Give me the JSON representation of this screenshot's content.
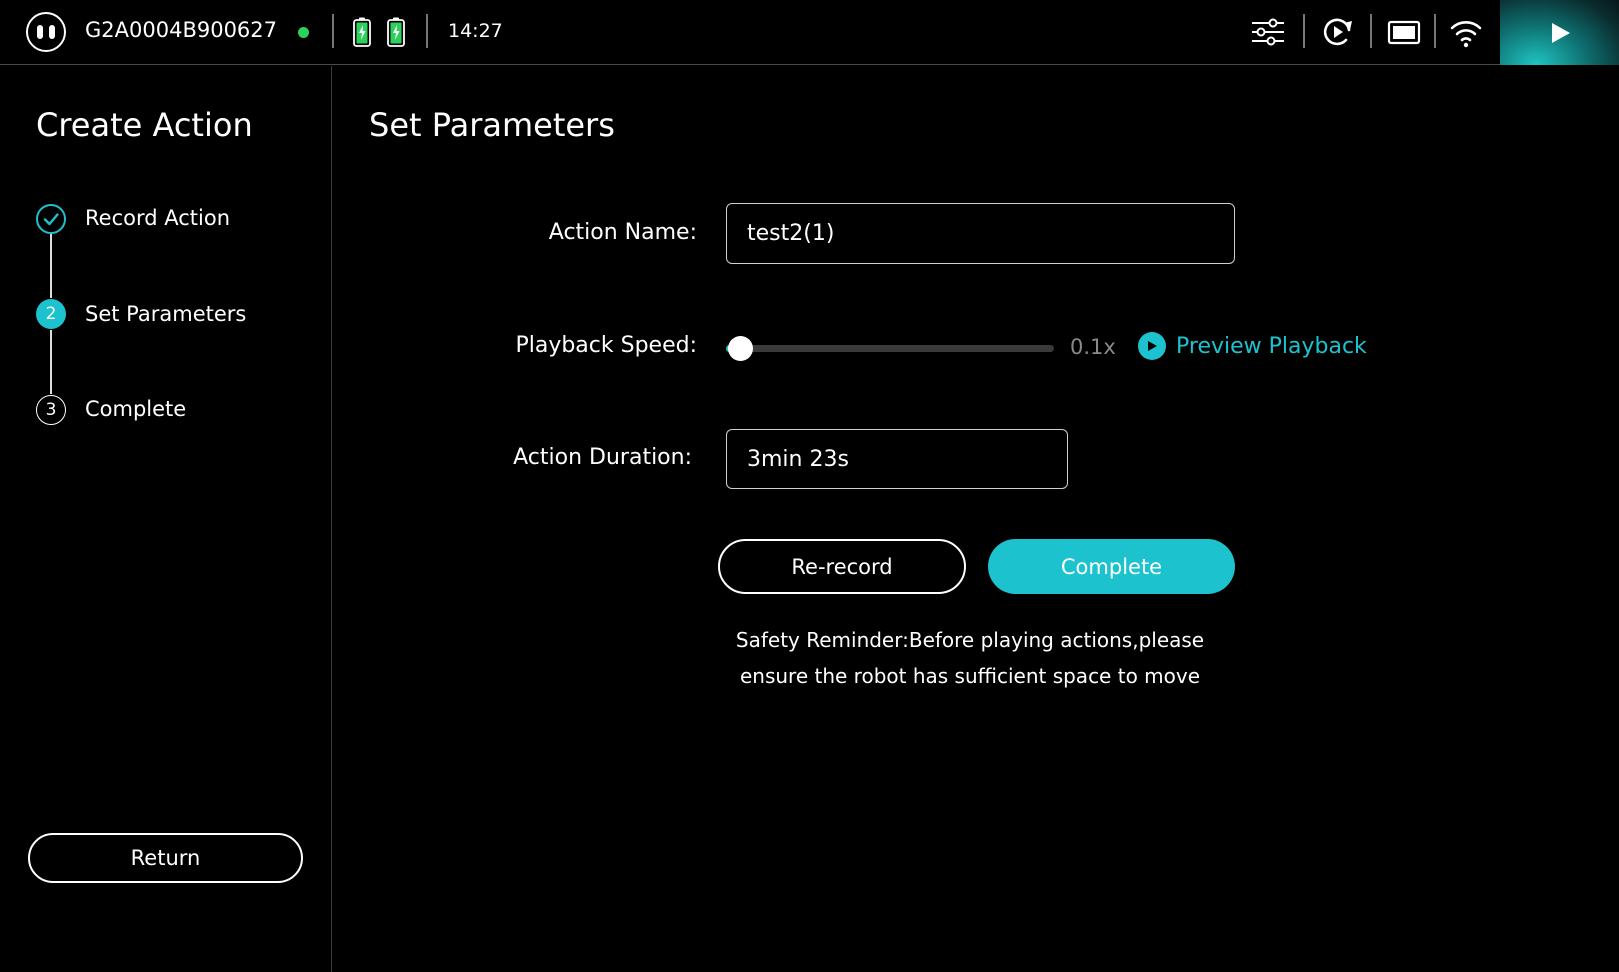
{
  "status_bar": {
    "device_id": "G2A0004B900627",
    "time": "14:27",
    "connection_status_color": "#2dd05a",
    "icons": [
      "robot-face-icon",
      "battery-charging-icon",
      "battery-charging-icon",
      "sliders-icon",
      "refresh-play-icon",
      "screen-icon",
      "wifi-icon",
      "play-icon"
    ]
  },
  "sidebar": {
    "title": "Create Action",
    "steps": [
      {
        "label": "Record Action",
        "state": "done"
      },
      {
        "label": "Set Parameters",
        "state": "active",
        "number": "2"
      },
      {
        "label": "Complete",
        "state": "todo",
        "number": "3"
      }
    ],
    "return_label": "Return"
  },
  "main": {
    "title": "Set Parameters",
    "action_name": {
      "label": "Action Name:",
      "value": "test2(1)"
    },
    "playback_speed": {
      "label": "Playback Speed:",
      "value_text": "0.1x",
      "level": 0.0
    },
    "preview_playback_label": "Preview Playback",
    "action_duration": {
      "label": "Action Duration:",
      "value": "3min 23s"
    },
    "rerecord_label": "Re-record",
    "complete_label": "Complete",
    "safety_line1": "Safety Reminder:Before playing actions,please",
    "safety_line2": "ensure the robot has sufficient space to move"
  },
  "colors": {
    "accent": "#1cc3cf",
    "background": "#000000"
  }
}
